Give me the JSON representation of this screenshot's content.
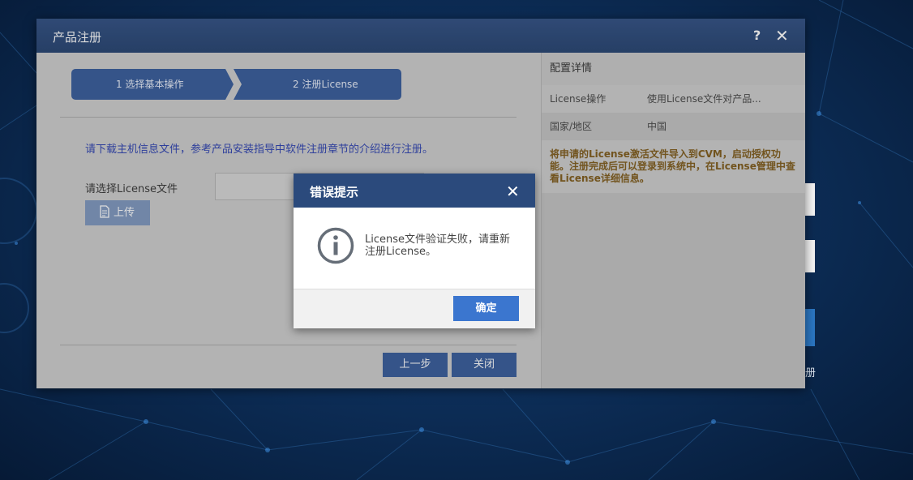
{
  "dialog": {
    "title": "产品注册",
    "help_label": "?",
    "close_label": "✕",
    "steps": [
      {
        "label": "1 选择基本操作"
      },
      {
        "label": "2 注册License"
      }
    ],
    "instruction": "请下载主机信息文件，参考产品安装指导中软件注册章节的介绍进行注册。",
    "file_label": "请选择License文件",
    "upload_label": "上传",
    "prev_label": "上一步",
    "close_btn_label": "关闭"
  },
  "config": {
    "title": "配置详情",
    "rows": [
      {
        "key": "License操作",
        "value": "使用License文件对产品..."
      },
      {
        "key": "国家/地区",
        "value": "中国"
      }
    ],
    "note": "将申请的License激活文件导入到CVM，启动授权功能。注册完成后可以登录到系统中，在License管理中查看License详细信息。"
  },
  "error_modal": {
    "title": "错误提示",
    "close_label": "✕",
    "message": "License文件验证失败，请重新注册License。",
    "ok_label": "确定",
    "icon": "info-icon"
  },
  "background": {
    "login_partial_text": "册"
  },
  "colors": {
    "header": "#2d4d82",
    "step": "#34599a",
    "ok_button": "#3b76cf",
    "note_text": "#7e5a18",
    "instruction_text": "#2a3fb0"
  }
}
